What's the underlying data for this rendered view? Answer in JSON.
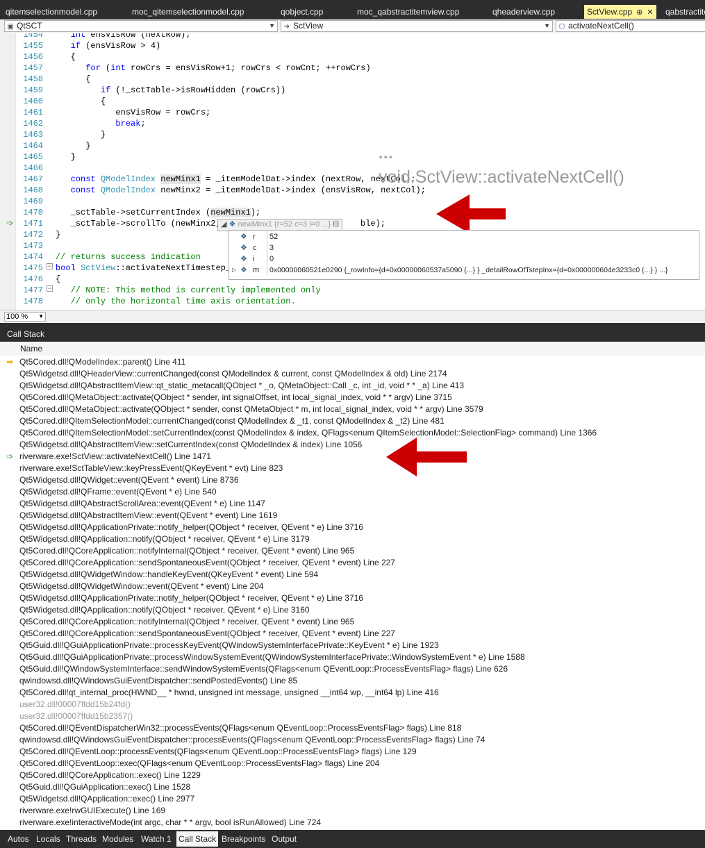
{
  "tabs": [
    {
      "label": "qitemselectionmodel.cpp"
    },
    {
      "label": "moc_qitemselectionmodel.cpp"
    },
    {
      "label": "qobject.cpp"
    },
    {
      "label": "moc_qabstractitemview.cpp"
    },
    {
      "label": "qheaderview.cpp"
    },
    {
      "label": "SctView.cpp",
      "active": true
    },
    {
      "label": "qabstractite"
    }
  ],
  "nav": {
    "project": "QtSCT",
    "class_scope": "SctView",
    "member": "activateNextCell()"
  },
  "code_lines": [
    {
      "n": "1454",
      "text": "   int ensVisRow (nextRow);"
    },
    {
      "n": "1455",
      "text": "   if (ensVisRow > 4)"
    },
    {
      "n": "1456",
      "text": "   {"
    },
    {
      "n": "1457",
      "text": "      for (int rowCrs = ensVisRow+1; rowCrs < rowCnt; ++rowCrs)"
    },
    {
      "n": "1458",
      "text": "      {"
    },
    {
      "n": "1459",
      "text": "         if (!_sctTable->isRowHidden (rowCrs))"
    },
    {
      "n": "1460",
      "text": "         {"
    },
    {
      "n": "1461",
      "text": "            ensVisRow = rowCrs;"
    },
    {
      "n": "1462",
      "text": "            break;"
    },
    {
      "n": "1463",
      "text": "         }"
    },
    {
      "n": "1464",
      "text": "      }"
    },
    {
      "n": "1465",
      "text": "   }"
    },
    {
      "n": "1466",
      "text": ""
    },
    {
      "n": "1467",
      "text": "   const QModelIndex newMinx1 = _itemModelDat->index (nextRow, nextCol);"
    },
    {
      "n": "1468",
      "text": "   const QModelIndex newMinx2 = _itemModelDat->index (ensVisRow, nextCol);"
    },
    {
      "n": "1469",
      "text": ""
    },
    {
      "n": "1470",
      "text": "   _sctTable->setCurrentIndex (newMinx1);"
    },
    {
      "n": "1471",
      "text": "   _sctTable->scrollTo (newMinx2,"
    },
    {
      "n": "1472",
      "text": "}"
    },
    {
      "n": "1473",
      "text": ""
    },
    {
      "n": "1474",
      "text": "// returns success indication"
    },
    {
      "n": "1475",
      "text": "bool SctView::activateNextTimestep_h"
    },
    {
      "n": "1476",
      "text": "{"
    },
    {
      "n": "1477",
      "text": "   // NOTE: This method is currently implemented only"
    },
    {
      "n": "1478",
      "text": "   // only the horizontal time axis orientation."
    }
  ],
  "code_tail_1471": "ble);",
  "overlay": {
    "dots": "...",
    "signature": "void SctView::activateNextCell()"
  },
  "datatip": {
    "header": "newMinx1 {r=52 c=3 i=0 ...}",
    "rows": [
      {
        "name": "r",
        "value": "52"
      },
      {
        "name": "c",
        "value": "3"
      },
      {
        "name": "i",
        "value": "0"
      },
      {
        "name": "m",
        "value": "0x00000060521e0290 {_rowInfo={d=0x00000060537a5090 {...} } _detailRowOfTstepInx={d=0x000000604e3233c0 {...} } ...}"
      }
    ]
  },
  "zoom": "100 %",
  "callstack": {
    "title": "Call Stack",
    "column": "Name",
    "frames": [
      {
        "text": "Qt5Cored.dll!QModelIndex::parent() Line 411",
        "marker": "current"
      },
      {
        "text": "Qt5Widgetsd.dll!QHeaderView::currentChanged(const QModelIndex & current, const QModelIndex & old) Line 2174"
      },
      {
        "text": "Qt5Widgetsd.dll!QAbstractItemView::qt_static_metacall(QObject * _o, QMetaObject::Call _c, int _id, void * * _a) Line 413"
      },
      {
        "text": "Qt5Cored.dll!QMetaObject::activate(QObject * sender, int signalOffset, int local_signal_index, void * * argv) Line 3715"
      },
      {
        "text": "Qt5Cored.dll!QMetaObject::activate(QObject * sender, const QMetaObject * m, int local_signal_index, void * * argv) Line 3579"
      },
      {
        "text": "Qt5Cored.dll!QItemSelectionModel::currentChanged(const QModelIndex & _t1, const QModelIndex & _t2) Line 481"
      },
      {
        "text": "Qt5Cored.dll!QItemSelectionModel::setCurrentIndex(const QModelIndex & index, QFlags<enum QItemSelectionModel::SelectionFlag> command) Line 1366"
      },
      {
        "text": "Qt5Widgetsd.dll!QAbstractItemView::setCurrentIndex(const QModelIndex & index) Line 1056"
      },
      {
        "text": "riverware.exe!SctView::activateNextCell() Line 1471",
        "marker": "call"
      },
      {
        "text": "riverware.exe!SctTableView::keyPressEvent(QKeyEvent * evt) Line 823"
      },
      {
        "text": "Qt5Widgetsd.dll!QWidget::event(QEvent * event) Line 8736"
      },
      {
        "text": "Qt5Widgetsd.dll!QFrame::event(QEvent * e) Line 540"
      },
      {
        "text": "Qt5Widgetsd.dll!QAbstractScrollArea::event(QEvent * e) Line 1147"
      },
      {
        "text": "Qt5Widgetsd.dll!QAbstractItemView::event(QEvent * event) Line 1619"
      },
      {
        "text": "Qt5Widgetsd.dll!QApplicationPrivate::notify_helper(QObject * receiver, QEvent * e) Line 3716"
      },
      {
        "text": "Qt5Widgetsd.dll!QApplication::notify(QObject * receiver, QEvent * e) Line 3179"
      },
      {
        "text": "Qt5Cored.dll!QCoreApplication::notifyInternal(QObject * receiver, QEvent * event) Line 965"
      },
      {
        "text": "Qt5Cored.dll!QCoreApplication::sendSpontaneousEvent(QObject * receiver, QEvent * event) Line 227"
      },
      {
        "text": "Qt5Widgetsd.dll!QWidgetWindow::handleKeyEvent(QKeyEvent * event) Line 594"
      },
      {
        "text": "Qt5Widgetsd.dll!QWidgetWindow::event(QEvent * event) Line 204"
      },
      {
        "text": "Qt5Widgetsd.dll!QApplicationPrivate::notify_helper(QObject * receiver, QEvent * e) Line 3716"
      },
      {
        "text": "Qt5Widgetsd.dll!QApplication::notify(QObject * receiver, QEvent * e) Line 3160"
      },
      {
        "text": "Qt5Cored.dll!QCoreApplication::notifyInternal(QObject * receiver, QEvent * event) Line 965"
      },
      {
        "text": "Qt5Cored.dll!QCoreApplication::sendSpontaneousEvent(QObject * receiver, QEvent * event) Line 227"
      },
      {
        "text": "Qt5Guid.dll!QGuiApplicationPrivate::processKeyEvent(QWindowSystemInterfacePrivate::KeyEvent * e) Line 1923"
      },
      {
        "text": "Qt5Guid.dll!QGuiApplicationPrivate::processWindowSystemEvent(QWindowSystemInterfacePrivate::WindowSystemEvent * e) Line 1588"
      },
      {
        "text": "Qt5Guid.dll!QWindowSystemInterface::sendWindowSystemEvents(QFlags<enum QEventLoop::ProcessEventsFlag> flags) Line 626"
      },
      {
        "text": "qwindowsd.dll!QWindowsGuiEventDispatcher::sendPostedEvents() Line 85"
      },
      {
        "text": "Qt5Cored.dll!qt_internal_proc(HWND__ * hwnd, unsigned int message, unsigned __int64 wp, __int64 lp) Line 416"
      },
      {
        "text": "user32.dll!00007ffdd15b24fd()",
        "dim": true
      },
      {
        "text": "user32.dll!00007ffdd15b2357()",
        "dim": true
      },
      {
        "text": "Qt5Cored.dll!QEventDispatcherWin32::processEvents(QFlags<enum QEventLoop::ProcessEventsFlag> flags) Line 818"
      },
      {
        "text": "qwindowsd.dll!QWindowsGuiEventDispatcher::processEvents(QFlags<enum QEventLoop::ProcessEventsFlag> flags) Line 74"
      },
      {
        "text": "Qt5Cored.dll!QEventLoop::processEvents(QFlags<enum QEventLoop::ProcessEventsFlag> flags) Line 129"
      },
      {
        "text": "Qt5Cored.dll!QEventLoop::exec(QFlags<enum QEventLoop::ProcessEventsFlag> flags) Line 204"
      },
      {
        "text": "Qt5Cored.dll!QCoreApplication::exec() Line 1229"
      },
      {
        "text": "Qt5Guid.dll!QGuiApplication::exec() Line 1528"
      },
      {
        "text": "Qt5Widgetsd.dll!QApplication::exec() Line 2977"
      },
      {
        "text": "riverware.exe!rwGUIExecute() Line 169"
      },
      {
        "text": "riverware.exe!interactiveMode(int argc, char * * argv, bool isRunAllowed) Line 724"
      }
    ]
  },
  "bottom_tabs": [
    {
      "label": "Autos"
    },
    {
      "label": "Locals"
    },
    {
      "label": "Threads"
    },
    {
      "label": "Modules"
    },
    {
      "label": "Watch 1"
    },
    {
      "label": "Call Stack",
      "active": true
    },
    {
      "label": "Breakpoints"
    },
    {
      "label": "Output"
    }
  ],
  "colors": {
    "accent_active_tab": "#fff7a0",
    "annotation_arrow": "#cc0000",
    "chrome_dark": "#2d2d30"
  }
}
